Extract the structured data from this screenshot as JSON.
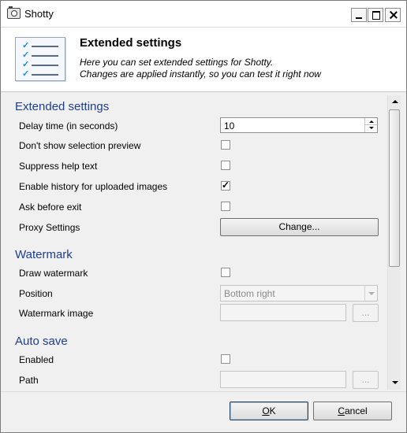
{
  "window": {
    "title": "Shotty"
  },
  "header": {
    "title": "Extended settings",
    "description_line1": "Here you can set extended settings for Shotty.",
    "description_line2": "Changes are applied instantly, so you can test it right now"
  },
  "sections": {
    "extended": {
      "title": "Extended settings",
      "delay_label": "Delay time (in seconds)",
      "delay_value": "10",
      "no_preview_label": "Don't show selection preview",
      "no_preview_checked": false,
      "suppress_help_label": "Suppress help text",
      "suppress_help_checked": false,
      "history_label": "Enable history for uploaded images",
      "history_checked": true,
      "ask_exit_label": "Ask before exit",
      "ask_exit_checked": false,
      "proxy_label": "Proxy Settings",
      "proxy_button": "Change..."
    },
    "watermark": {
      "title": "Watermark",
      "draw_label": "Draw watermark",
      "draw_checked": false,
      "position_label": "Position",
      "position_value": "Bottom right",
      "image_label": "Watermark image",
      "browse_button": "..."
    },
    "autosave": {
      "title": "Auto save",
      "enabled_label": "Enabled",
      "enabled_checked": false,
      "path_label": "Path",
      "browse_button": "..."
    }
  },
  "footer": {
    "ok_first": "O",
    "ok_rest": "K",
    "cancel_first": "C",
    "cancel_rest": "ancel"
  },
  "icons": [
    "app-camera-icon",
    "minimize-icon",
    "maximize-icon",
    "close-icon",
    "checklist-icon",
    "spin-up-icon",
    "spin-down-icon",
    "dropdown-arrow-icon",
    "scroll-up-icon",
    "scroll-down-icon"
  ]
}
